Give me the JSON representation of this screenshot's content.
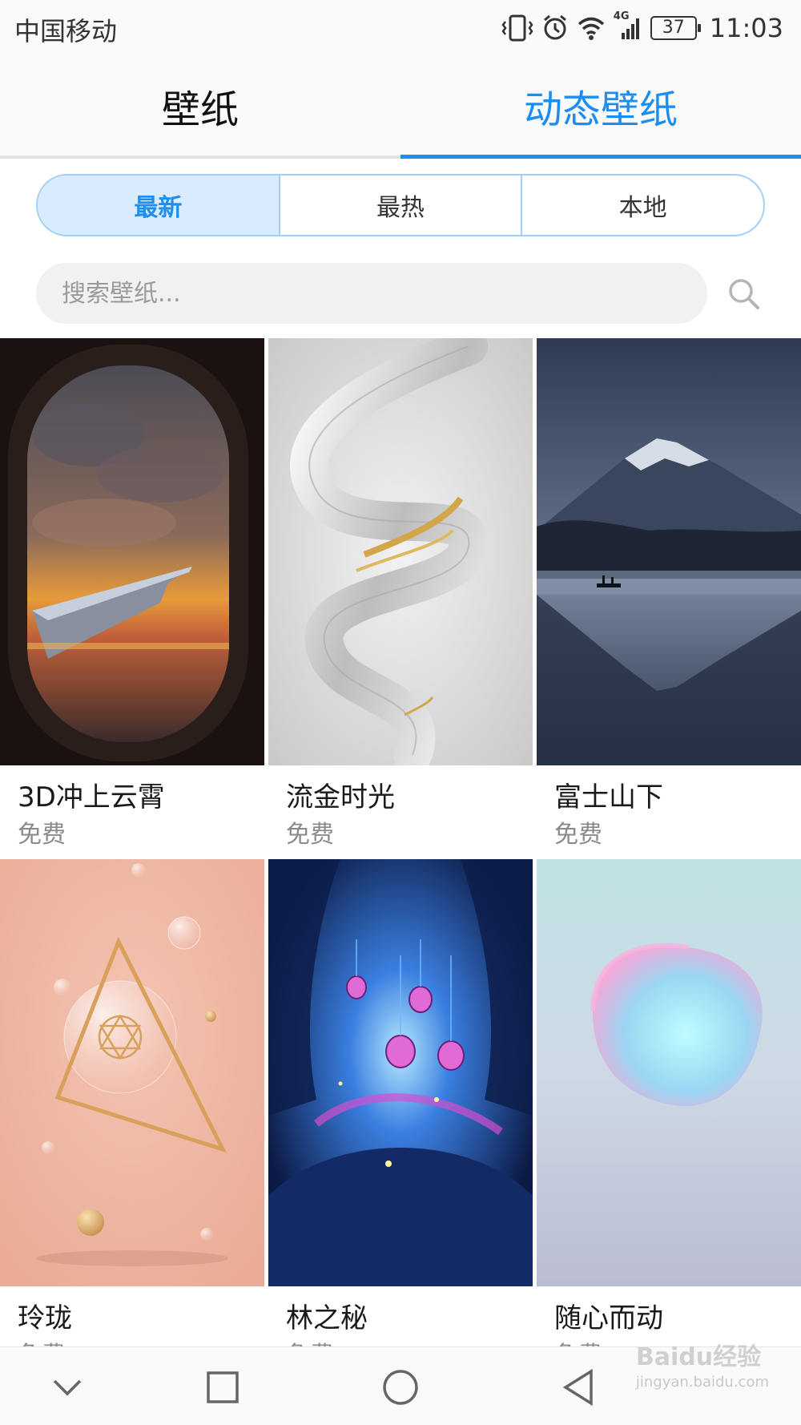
{
  "status_bar": {
    "carrier": "中国移动",
    "network": "4G",
    "battery": "37",
    "time": "11:03"
  },
  "main_tabs": [
    {
      "label": "壁纸",
      "active": false
    },
    {
      "label": "动态壁纸",
      "active": true
    }
  ],
  "filter_tabs": [
    {
      "label": "最新",
      "active": true
    },
    {
      "label": "最热",
      "active": false
    },
    {
      "label": "本地",
      "active": false
    }
  ],
  "search": {
    "placeholder": "搜索壁纸...",
    "icon": "search-icon"
  },
  "wallpapers": [
    {
      "title": "3D冲上云霄",
      "price": "免费",
      "theme": "airplane-window-sunset"
    },
    {
      "title": "流金时光",
      "price": "免费",
      "theme": "silver-gold-swirl"
    },
    {
      "title": "富士山下",
      "price": "免费",
      "theme": "mount-fuji-lake"
    },
    {
      "title": "玲珑",
      "price": "免费",
      "theme": "pink-geometric-spheres"
    },
    {
      "title": "林之秘",
      "price": "免费",
      "theme": "enchanted-blue-forest"
    },
    {
      "title": "随心而动",
      "price": "免费",
      "theme": "iridescent-blob"
    }
  ],
  "nav_bar": {
    "icons": [
      "chevron-down-icon",
      "square-icon",
      "circle-icon",
      "back-triangle-icon"
    ]
  },
  "watermark": {
    "brand": "Baidu经验",
    "url": "jingyan.baidu.com"
  },
  "colors": {
    "accent": "#1d8ef0",
    "segment_active_bg": "#d9ecfd",
    "segment_border": "#9fd0fb"
  }
}
